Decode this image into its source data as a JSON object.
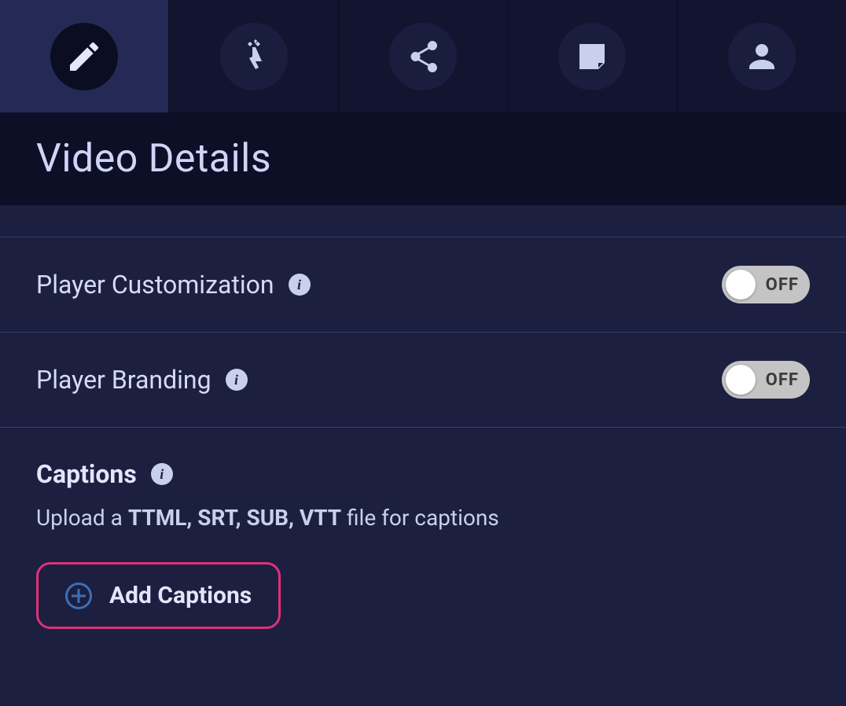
{
  "page_title": "Video Details",
  "tabs": [
    {
      "id": "edit",
      "icon": "pencil",
      "active": true
    },
    {
      "id": "interact",
      "icon": "pointer",
      "active": false
    },
    {
      "id": "share",
      "icon": "share",
      "active": false
    },
    {
      "id": "note",
      "icon": "note",
      "active": false
    },
    {
      "id": "user",
      "icon": "user",
      "active": false
    }
  ],
  "rows": {
    "player_customization": {
      "label": "Player Customization",
      "toggle": "OFF"
    },
    "player_branding": {
      "label": "Player Branding",
      "toggle": "OFF"
    }
  },
  "captions": {
    "title": "Captions",
    "desc_prefix": "Upload a ",
    "desc_formats": "TTML, SRT, SUB, VTT",
    "desc_suffix": " file for captions",
    "button_label": "Add Captions"
  }
}
